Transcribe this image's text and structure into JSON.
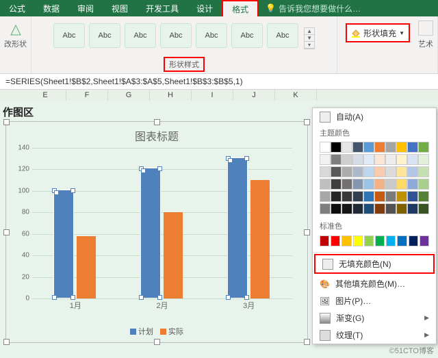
{
  "tabs": {
    "items": [
      "公式",
      "数据",
      "审阅",
      "视图",
      "开发工具",
      "设计",
      "格式"
    ],
    "active": "格式",
    "tell_me": "告诉我您想要做什么…"
  },
  "ribbon": {
    "edit_shape": "改形状",
    "styles_label": "形状样式",
    "style_items": [
      "Abc",
      "Abc",
      "Abc",
      "Abc",
      "Abc",
      "Abc",
      "Abc"
    ],
    "fill_label": "形状填充",
    "art_label": "艺术"
  },
  "formula": "=SERIES(Sheet1!$B$2,Sheet1!$A$3:$A$5,Sheet1!$B$3:$B$5,1)",
  "columns": [
    "E",
    "F",
    "G",
    "H",
    "I",
    "J",
    "K"
  ],
  "chart_area_label": "作图区",
  "chart_data": {
    "type": "bar",
    "title": "图表标题",
    "categories": [
      "1月",
      "2月",
      "3月"
    ],
    "series": [
      {
        "name": "计划",
        "values": [
          100,
          120,
          130
        ],
        "color": "#4f81bd"
      },
      {
        "name": "实际",
        "values": [
          58,
          80,
          110
        ],
        "color": "#ed7d31"
      }
    ],
    "ylim": [
      0,
      140
    ],
    "ystep": 20
  },
  "dropdown": {
    "auto": "自动(A)",
    "theme_colors": "主题颜色",
    "theme_grid": [
      [
        "#ffffff",
        "#000000",
        "#e7e6e6",
        "#44546a",
        "#5b9bd5",
        "#ed7d31",
        "#a5a5a5",
        "#ffc000",
        "#4472c4",
        "#70ad47"
      ],
      [
        "#f2f2f2",
        "#7f7f7f",
        "#d0cece",
        "#d6dce5",
        "#deebf7",
        "#fbe5d6",
        "#ededed",
        "#fff2cc",
        "#d9e2f3",
        "#e2efda"
      ],
      [
        "#d9d9d9",
        "#595959",
        "#aeabab",
        "#adb9ca",
        "#bdd7ee",
        "#f7cbac",
        "#dbdbdb",
        "#fee599",
        "#b4c6e7",
        "#c5e0b3"
      ],
      [
        "#bfbfbf",
        "#3f3f3f",
        "#757070",
        "#8496b0",
        "#9cc3e6",
        "#f4b183",
        "#c9c9c9",
        "#ffd965",
        "#8eaadb",
        "#a8d08d"
      ],
      [
        "#a6a6a6",
        "#262626",
        "#3a3838",
        "#323f4f",
        "#2e75b6",
        "#c55a11",
        "#7b7b7b",
        "#bf9000",
        "#2f5496",
        "#538135"
      ],
      [
        "#7f7f7f",
        "#0d0d0d",
        "#171616",
        "#222a35",
        "#1f4e79",
        "#833c0b",
        "#525252",
        "#7f6000",
        "#1f3864",
        "#375623"
      ]
    ],
    "standard_colors": "标准色",
    "standard_row": [
      "#c00000",
      "#ff0000",
      "#ffc000",
      "#ffff00",
      "#92d050",
      "#00b050",
      "#00b0f0",
      "#0070c0",
      "#002060",
      "#7030a0"
    ],
    "no_fill": "无填充颜色(N)",
    "more_colors": "其他填充颜色(M)…",
    "picture": "图片(P)…",
    "gradient": "渐变(G)",
    "texture": "纹理(T)"
  },
  "watermark": "©51CTO博客"
}
